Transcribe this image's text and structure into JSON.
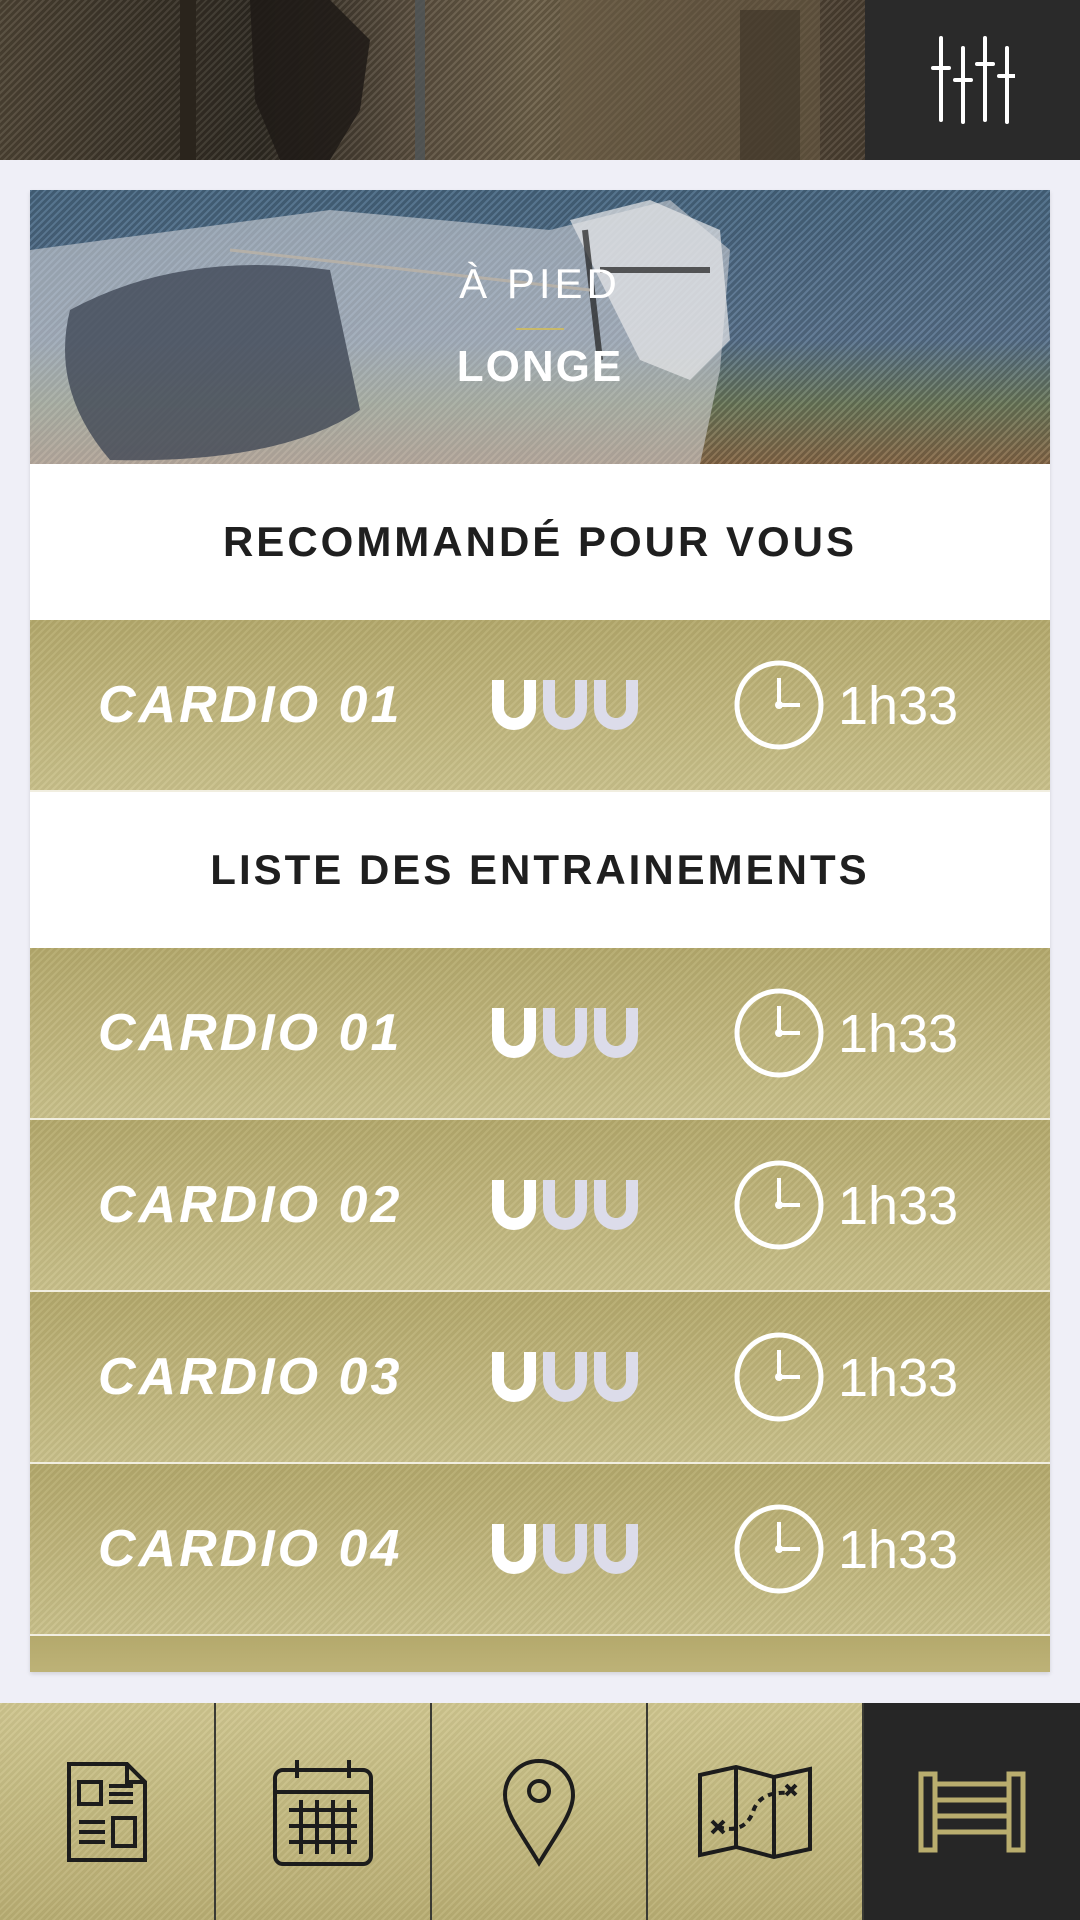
{
  "header": {
    "filter_icon": "sliders-icon"
  },
  "hero": {
    "category": "À PIED",
    "title": "LONGE"
  },
  "recommended": {
    "heading": "RECOMMANDÉ POUR VOUS",
    "item": {
      "name": "CARDIO 01",
      "difficulty": 1,
      "difficulty_max": 3,
      "duration": "1h33"
    }
  },
  "list": {
    "heading": "LISTE DES ENTRAINEMENTS",
    "items": [
      {
        "name": "CARDIO 01",
        "difficulty": 1,
        "difficulty_max": 3,
        "duration": "1h33"
      },
      {
        "name": "CARDIO 02",
        "difficulty": 1,
        "difficulty_max": 3,
        "duration": "1h33"
      },
      {
        "name": "CARDIO 03",
        "difficulty": 1,
        "difficulty_max": 3,
        "duration": "1h33"
      },
      {
        "name": "CARDIO 04",
        "difficulty": 1,
        "difficulty_max": 3,
        "duration": "1h33"
      }
    ]
  },
  "nav": {
    "tabs": [
      {
        "icon": "document-icon",
        "active": false
      },
      {
        "icon": "calendar-icon",
        "active": false
      },
      {
        "icon": "map-pin-icon",
        "active": false
      },
      {
        "icon": "map-icon",
        "active": false
      },
      {
        "icon": "fence-icon",
        "active": true
      }
    ]
  },
  "colors": {
    "gold": "#c2b87e",
    "dark": "#262626",
    "page_bg": "#efeff7",
    "shoe_filled": "#ffffff",
    "shoe_empty": "#dcdcea"
  }
}
